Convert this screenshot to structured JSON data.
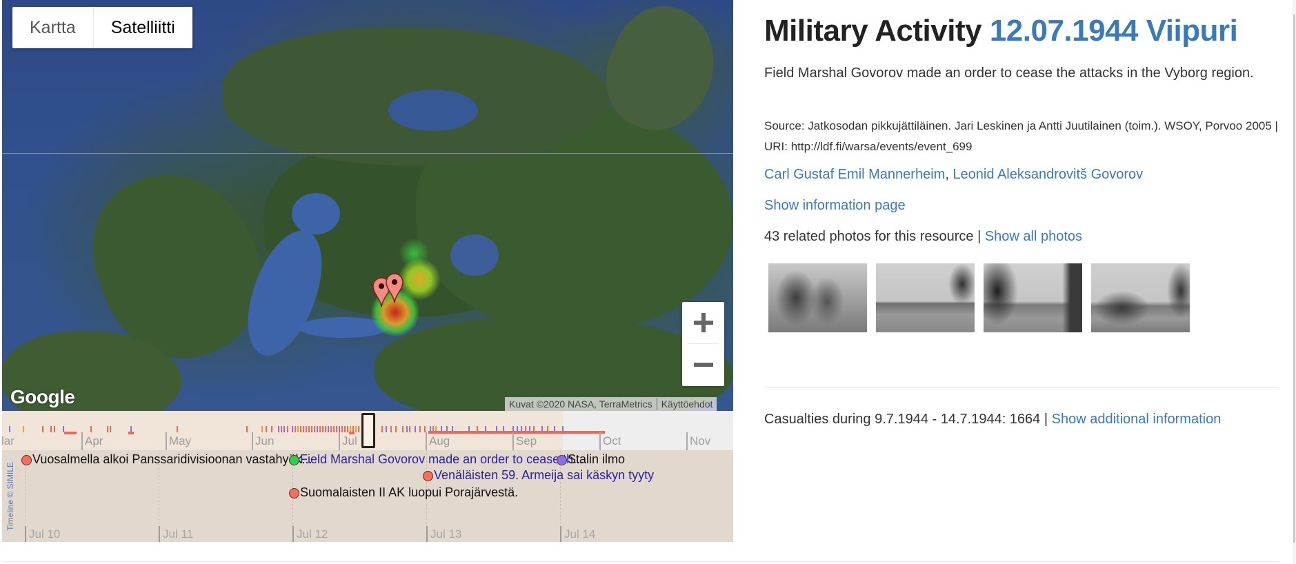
{
  "map": {
    "type_buttons": [
      {
        "label": "Kartta",
        "active": false
      },
      {
        "label": "Satelliitti",
        "active": true
      }
    ],
    "zoom_in_icon": "plus-icon",
    "zoom_out_icon": "minus-icon",
    "logo": "Google",
    "attribution": "Kuvat ©2020 NASA, TerraMetrics",
    "terms": "Käyttöehdot",
    "marker_color": "#f28b82",
    "heat_colors": [
      "#3fd13f",
      "#f0d020",
      "#d42020"
    ]
  },
  "timeline": {
    "credit": "Timeline © SIMILE",
    "overview_months": [
      "lar",
      "Apr",
      "May",
      "Jun",
      "Jul",
      "Aug",
      "Sep",
      "Oct",
      "Nov"
    ],
    "detail_days": [
      "Jul 10",
      "Jul 11",
      "Jul 12",
      "Jul 13",
      "Jul 14"
    ],
    "events": [
      {
        "text": "Vuosalmella alkoi Panssaridivisioonan vastahyök...",
        "color": "#f07060",
        "link": false
      },
      {
        "text": "Field Marshal Govorov made an order to cease th...",
        "color": "#22d44a",
        "link": true
      },
      {
        "text": "Suomalaisten II AK luopui Porajärvestä.",
        "color": "#f07060",
        "link": false
      },
      {
        "text": "Venäläisten 59. Armeija sai käskyn tyyty",
        "color": "#f07060",
        "link": true
      },
      {
        "text": "Stalin ilmo",
        "color": "#8a6ef0",
        "link": false
      }
    ],
    "event_colors": {
      "red": "#ea6a5a",
      "purple": "#8a6ef0",
      "orange": "#f0a030"
    }
  },
  "panel": {
    "title_prefix": "Military Activity",
    "title_date_place": "12.07.1944 Viipuri",
    "description": "Field Marshal Govorov made an order to cease the attacks in the Vyborg region.",
    "source": "Source: Jatkosodan pikkujättiläinen. Jari Leskinen ja Antti Juutilainen (toim.). WSOY, Porvoo 2005 | URI: http://ldf.fi/warsa/events/event_699",
    "people": [
      "Carl Gustaf Emil Mannerheim",
      "Leonid Aleksandrovitš Govorov"
    ],
    "people_separator": ", ",
    "info_link": "Show information page",
    "photos_count_text": "43 related photos for this resource",
    "photos_separator": " | ",
    "show_all_photos": "Show all photos",
    "thumbnails": [
      "photo-1",
      "photo-2",
      "photo-3",
      "photo-4"
    ],
    "casualties_text": "Casualties during 9.7.1944 - 14.7.1944: 1664",
    "casualties_separator": " | ",
    "additional_info": "Show additional information",
    "link_color": "#3a7ab8"
  }
}
